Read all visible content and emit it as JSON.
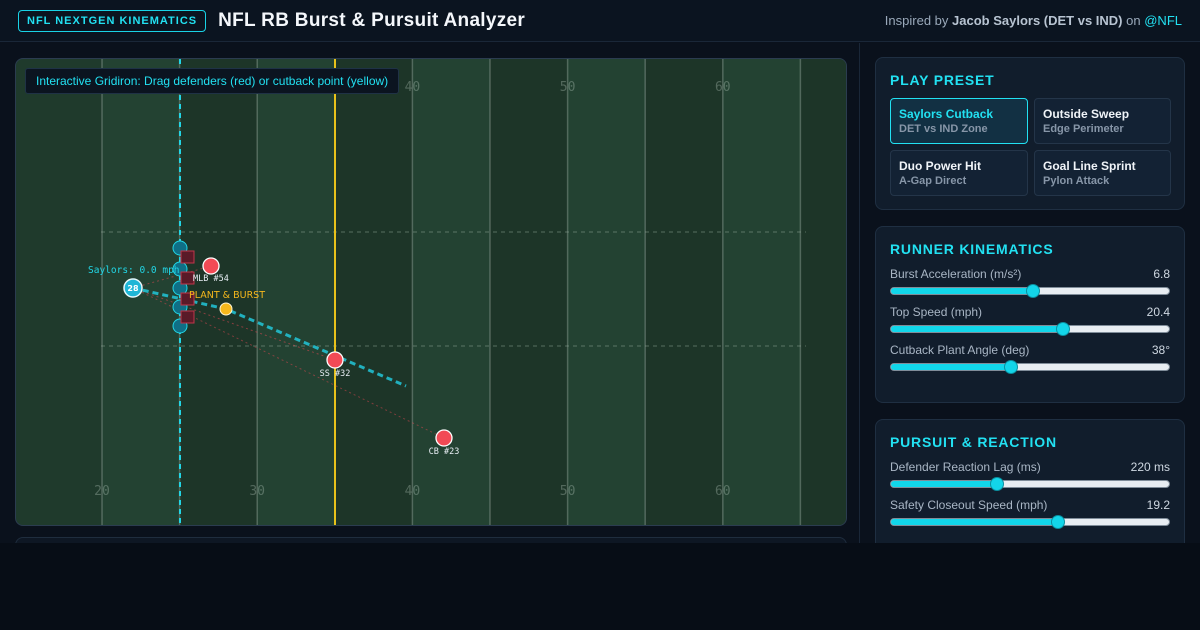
{
  "header": {
    "badge": "NFL NEXTGEN KINEMATICS",
    "title": "NFL RB Burst & Pursuit Analyzer",
    "credit_prefix": "Inspired by",
    "credit_player": "Jacob Saylors (DET vs IND)",
    "credit_on": "on",
    "credit_handle": "@NFL"
  },
  "field": {
    "tip": "Interactive Gridiron: Drag defenders (red) or cutback point (yellow)",
    "yard_numbers": [
      "20",
      "30",
      "40",
      "50",
      "60"
    ],
    "runner_label": "Saylors: 0.0 mph",
    "runner_number": "28",
    "cutback_label": "PLANT & BURST",
    "defenders": [
      "MLB #54",
      "SS #32",
      "CB #23"
    ],
    "colors": {
      "grass": "#1f3a2c",
      "scrimmage": "#22d6e6",
      "first_down": "#e8c21b",
      "defender": "#f24a55",
      "runner": "#1fb6d6",
      "cutback": "#f5b81c",
      "offense_lineman": "#0f6f86",
      "defense_lineman": "#5a1a28"
    }
  },
  "preset": {
    "title": "PLAY PRESET",
    "items": [
      {
        "name": "Saylors Cutback",
        "sub": "DET vs IND Zone"
      },
      {
        "name": "Outside Sweep",
        "sub": "Edge Perimeter"
      },
      {
        "name": "Duo Power Hit",
        "sub": "A-Gap Direct"
      },
      {
        "name": "Goal Line Sprint",
        "sub": "Pylon Attack"
      }
    ]
  },
  "kinematics": {
    "title": "RUNNER KINEMATICS",
    "sliders": [
      {
        "label": "Burst Acceleration (m/s²)",
        "value": "6.8",
        "level": 0.51
      },
      {
        "label": "Top Speed (mph)",
        "value": "20.4",
        "level": 0.62
      },
      {
        "label": "Cutback Plant Angle (deg)",
        "value": "38°",
        "level": 0.43
      }
    ]
  },
  "pursuit": {
    "title": "PURSUIT & REACTION",
    "sliders": [
      {
        "label": "Defender Reaction Lag (ms)",
        "value": "220 ms",
        "level": 0.38
      },
      {
        "label": "Safety Closeout Speed (mph)",
        "value": "19.2",
        "level": 0.6
      }
    ]
  }
}
